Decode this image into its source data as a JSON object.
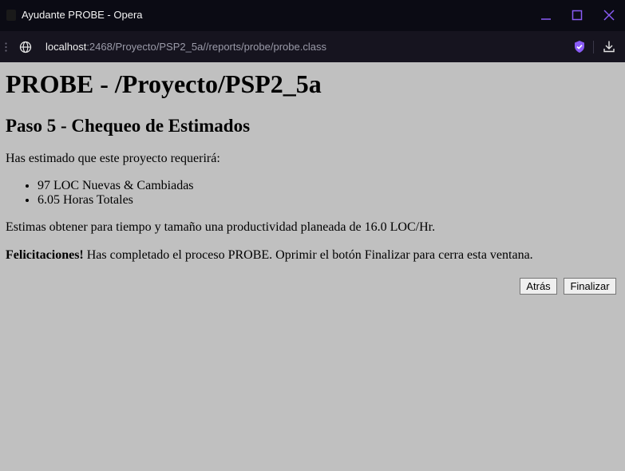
{
  "window": {
    "title": "Ayudante PROBE - Opera"
  },
  "address_bar": {
    "url_host": "localhost",
    "url_rest": ":2468/Proyecto/PSP2_5a//reports/probe/probe.class"
  },
  "icons": {
    "globe": "globe-icon",
    "shield": "shield-icon",
    "download": "download-icon",
    "minimize": "minimize-icon",
    "maximize": "maximize-icon",
    "close": "close-icon"
  },
  "colors": {
    "titlebar_bg": "#0b0b14",
    "accent": "#8a5cf6",
    "page_bg": "#c0c0c0"
  },
  "page": {
    "title": "PROBE - /Proyecto/PSP2_5a",
    "step_title": "Paso 5 - Chequeo de Estimados",
    "intro": "Has estimado que este proyecto requerirá:",
    "estimates": [
      "97 LOC Nuevas & Cambiadas",
      "6.05 Horas Totales"
    ],
    "productivity": "Estimas obtener para tiempo y tamaño una productividad planeada de 16.0 LOC/Hr.",
    "congrats_bold": "Felicitaciones!",
    "congrats_text": " Has completado el proceso PROBE. Oprimir el botón Finalizar para cerra esta ventana."
  },
  "buttons": {
    "back_label": "Atrás",
    "finish_label": "Finalizar"
  }
}
